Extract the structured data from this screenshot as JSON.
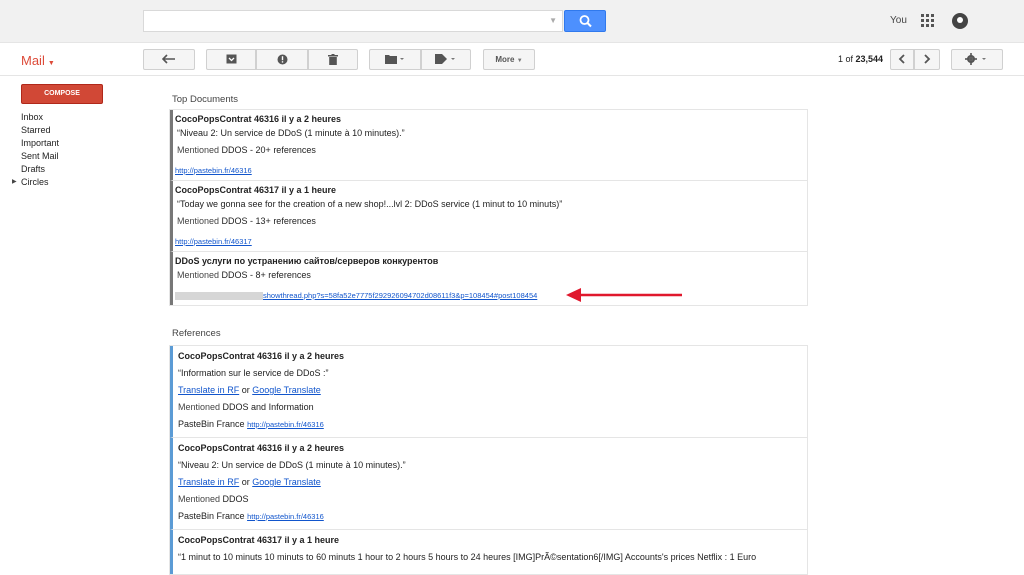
{
  "header": {
    "user_label": "You",
    "search_placeholder": ""
  },
  "toolbar": {
    "mail_label": "Mail",
    "more_label": "More",
    "pager_range": "1 of",
    "pager_total": "23,544"
  },
  "sidebar": {
    "compose_label": "COMPOSE",
    "items": [
      "Inbox",
      "Starred",
      "Important",
      "Sent Mail",
      "Drafts",
      "Circles"
    ]
  },
  "top_documents": {
    "title": "Top Documents",
    "items": [
      {
        "title": "CocoPopsContrat 46316 il y a 2 heures",
        "quote": "“Niveau 2: Un service de DDoS (1 minute à 10 minutes).”",
        "mentioned_prefix": "Mentioned",
        "mentioned_value": "DDOS - 20+ references",
        "link": "http://pastebin.fr/46316"
      },
      {
        "title": "CocoPopsContrat 46317 il y a 1 heure",
        "quote": "“Today we gonna see for the creation of a new shop!...lvl 2: DDoS service (1 minut to 10 minuts)”",
        "mentioned_prefix": "Mentioned",
        "mentioned_value": "DDOS - 13+ references",
        "link": "http://pastebin.fr/46317"
      },
      {
        "title": "DDoS услуги по устранению сайтов/серверов конкурентов",
        "mentioned_prefix": "Mentioned",
        "mentioned_value": "DDOS - 8+ references",
        "link": "showthread.php?s=58fa52e7775f292926094702d08611f3&p=108454#post108454"
      }
    ]
  },
  "references": {
    "title": "References",
    "items": [
      {
        "title": "CocoPopsContrat 46316 il y a 2 heures",
        "quote": "“Information sur le service de DDoS :”",
        "translate_rf": "Translate in RF",
        "or": "or",
        "google_translate": "Google Translate",
        "mentioned_prefix": "Mentioned",
        "mentioned_value": "DDOS and Information",
        "source": "PasteBin France",
        "link": "http://pastebin.fr/46316"
      },
      {
        "title": "CocoPopsContrat 46316 il y a 2 heures",
        "quote": "“Niveau 2: Un service de DDoS (1 minute à 10 minutes).”",
        "translate_rf": "Translate in RF",
        "or": "or",
        "google_translate": "Google Translate",
        "mentioned_prefix": "Mentioned",
        "mentioned_value": "DDOS",
        "source": "PasteBin France",
        "link": "http://pastebin.fr/46316"
      },
      {
        "title": "CocoPopsContrat 46317 il y a 1 heure",
        "quote": "“1 minut to 10 minuts 10 minuts to 60 minuts 1 hour to 2 hours 5 hours to 24 heures [IMG]PrÃ©sentation6[/IMG] Accounts's prices Netflix : 1 Euro"
      }
    ]
  },
  "colors": {
    "accent_red": "#dd4b39",
    "compose_red": "#d14836",
    "search_blue": "#4d90fe",
    "arrow_red": "#e0182d",
    "ref_border": "#5b9bd5"
  }
}
